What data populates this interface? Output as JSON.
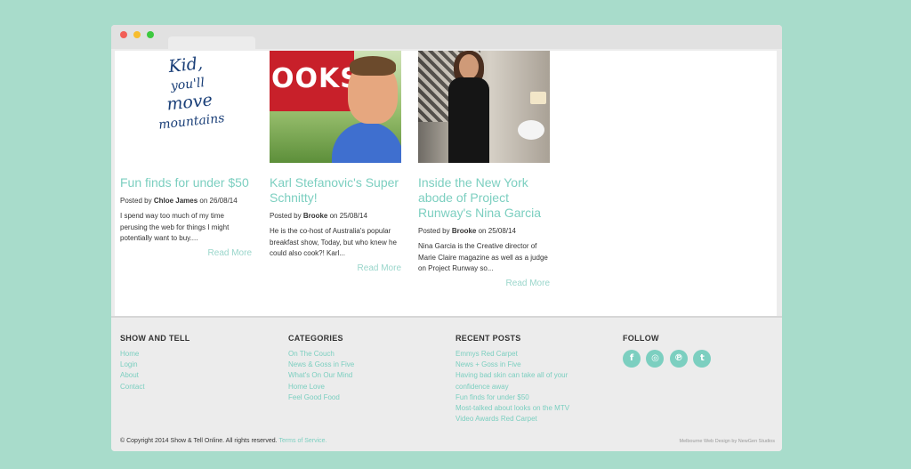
{
  "browser": {},
  "posts": [
    {
      "image_alt": "Kid, you'll move mountains",
      "title": "Fun finds for under $50",
      "posted_prefix": "Posted by",
      "author": "Chloe James",
      "date_prefix": "on",
      "date": "26/08/14",
      "excerpt": "I spend way too much of my time perusing the web for things I might potentially want to buy....",
      "read_more": "Read More"
    },
    {
      "image_text": "OOKS",
      "title": "Karl Stefanovic's Super Schnitty!",
      "posted_prefix": "Posted by",
      "author": "Brooke",
      "date_prefix": "on",
      "date": "25/08/14",
      "excerpt": "He is the co-host of Australia's popular breakfast show, Today, but who knew he could also cook?! Karl...",
      "read_more": "Read More"
    },
    {
      "title": "Inside the New York abode of Project Runway's Nina Garcia",
      "posted_prefix": "Posted by",
      "author": "Brooke",
      "date_prefix": "on",
      "date": "25/08/14",
      "excerpt": "Nina Garcia is the Creative director of Marie Claire magazine as well as a judge on Project Runway so...",
      "read_more": "Read More"
    }
  ],
  "footer": {
    "show_and_tell": {
      "heading": "SHOW AND TELL",
      "links": [
        "Home",
        "Login",
        "About",
        "Contact"
      ]
    },
    "categories": {
      "heading": "CATEGORIES",
      "links": [
        "On The Couch",
        "News & Goss in Five",
        "What's On Our Mind",
        "Home Love",
        "Feel Good Food"
      ]
    },
    "recent_posts": {
      "heading": "RECENT POSTS",
      "links": [
        "Emmys Red Carpet",
        "News + Goss in Five",
        "Having bad skin can take all of your",
        "confidence away",
        "Fun finds for under $50",
        "Most-talked about looks on the MTV",
        "Video Awards Red Carpet"
      ]
    },
    "follow": {
      "heading": "FOLLOW",
      "icons": [
        {
          "name": "facebook-icon",
          "glyph": "f"
        },
        {
          "name": "instagram-icon",
          "glyph": "◎"
        },
        {
          "name": "pinterest-icon",
          "glyph": "℗"
        },
        {
          "name": "twitter-icon",
          "glyph": "t"
        }
      ]
    },
    "copyright": "© Copyright 2014 Show & Tell Online. All rights reserved.",
    "terms": "Terms of Service.",
    "credit": "Melbourne Web Design by NewGen Studios"
  },
  "colors": {
    "accent": "#7ccfc0",
    "background": "#a8dccb"
  }
}
